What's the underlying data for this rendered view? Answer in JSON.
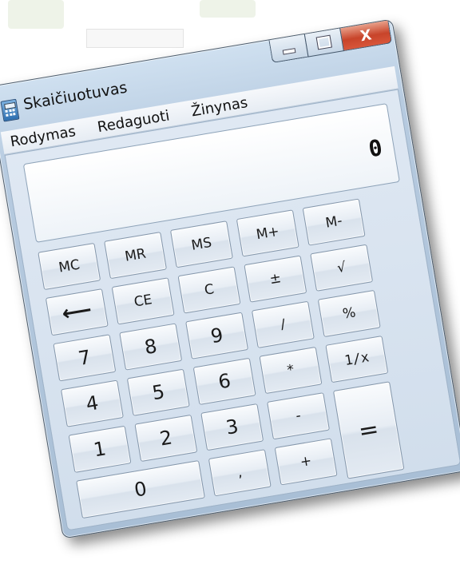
{
  "window": {
    "title": "Skaičiuotuvas",
    "controls": {
      "close_glyph": "X"
    }
  },
  "menu": {
    "items": [
      "Rodymas",
      "Redaguoti",
      "Žinynas"
    ]
  },
  "display": {
    "value": "0"
  },
  "keys": {
    "mc": "MC",
    "mr": "MR",
    "ms": "MS",
    "mplus": "M+",
    "mminus": "M-",
    "backspace": "⟵",
    "ce": "CE",
    "c": "C",
    "plusminus": "±",
    "sqrt": "√",
    "k7": "7",
    "k8": "8",
    "k9": "9",
    "divide": "/",
    "percent": "%",
    "k4": "4",
    "k5": "5",
    "k6": "6",
    "multiply": "*",
    "reciprocal": "1/x",
    "k1": "1",
    "k2": "2",
    "k3": "3",
    "minus": "-",
    "equals": "=",
    "k0": "0",
    "decimal": ",",
    "plus": "+"
  },
  "colors": {
    "close_button": "#c8442a",
    "frame": "#b7cbe0",
    "client": "#d9e3ef"
  }
}
